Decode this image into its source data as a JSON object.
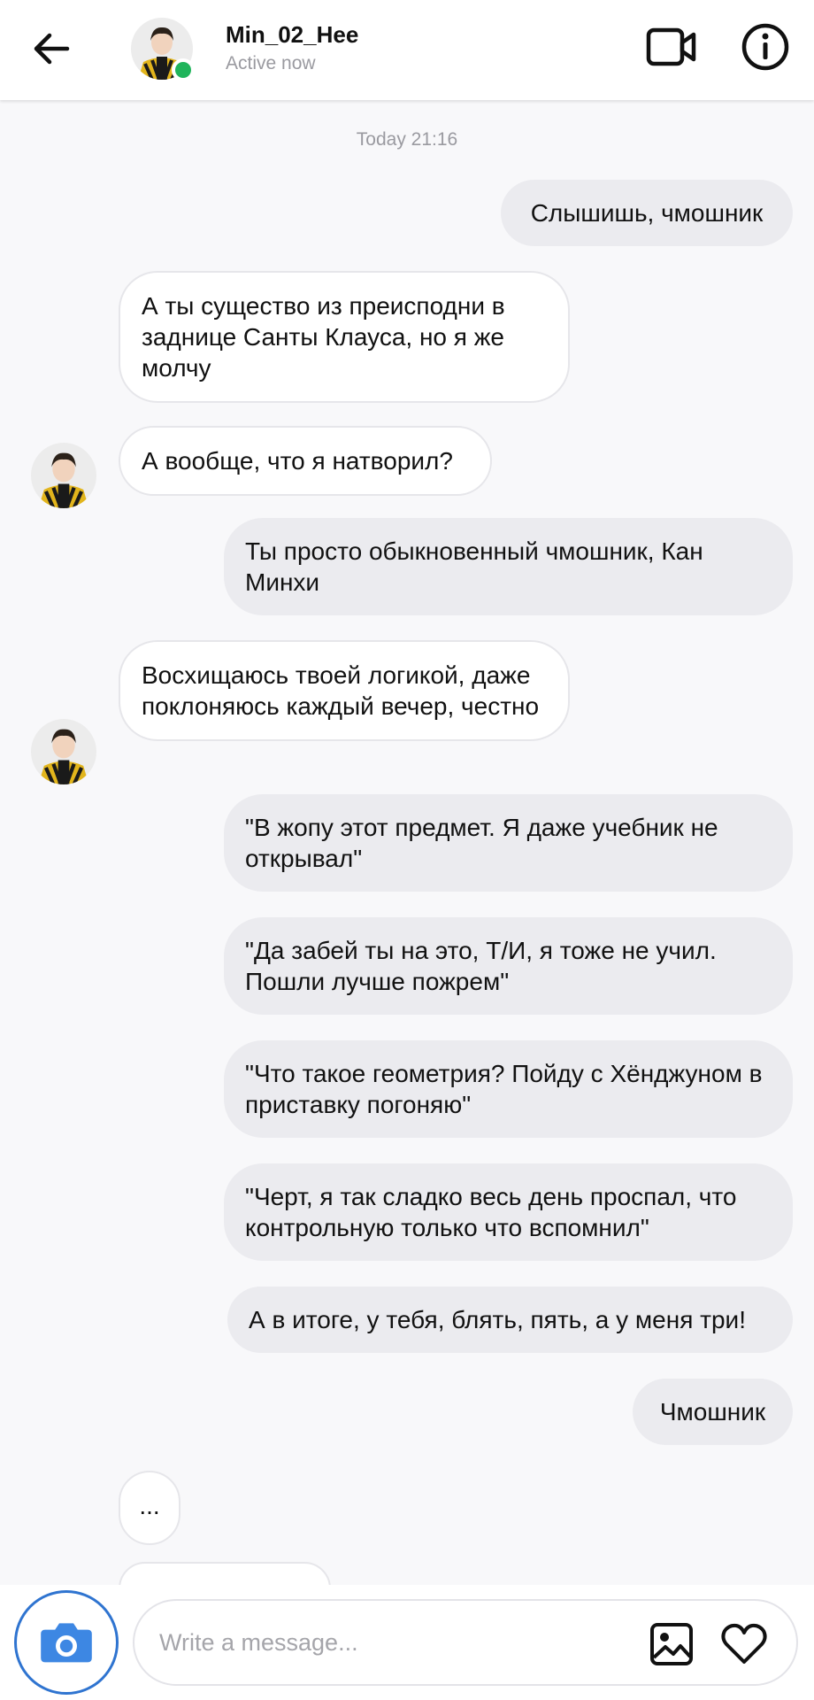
{
  "colors": {
    "online": "#1fb45b",
    "outgoing_bubble": "#ebebef",
    "incoming_bubble": "#ffffff",
    "camera_accent": "#2f74d0"
  },
  "header": {
    "back_icon": "arrow-left-icon",
    "avatar_icon": "user-avatar",
    "username": "Min_02_Hee",
    "status": "Active now",
    "video_icon": "video-camera-icon",
    "info_icon": "info-icon"
  },
  "chat": {
    "timestamp": "Today 21:16",
    "messages": [
      {
        "dir": "out",
        "text": "Слышишь, чмошник"
      },
      {
        "dir": "in",
        "text": "А ты существо из преисподни в заднице Санты Клауса, но я же молчу"
      },
      {
        "dir": "in",
        "text": "А вообще, что я натворил?"
      },
      {
        "dir": "out",
        "text": "Ты просто обыкновенный чмошник, Кан Минхи"
      },
      {
        "dir": "in",
        "text": "Восхищаюсь твоей логикой, даже поклоняюсь каждый вечер, честно"
      },
      {
        "dir": "out",
        "text": "\"В жопу этот предмет. Я даже учебник не открывал\""
      },
      {
        "dir": "out",
        "text": "\"Да забей ты на это, Т/И, я тоже не учил. Пошли лучше пожрем\""
      },
      {
        "dir": "out",
        "text": "\"Что такое геометрия? Пойду с Хёнджуном в приставку погоняю\""
      },
      {
        "dir": "out",
        "text": "\"Черт, я так сладко весь день проспал, что контрольную только что вспомнил\""
      },
      {
        "dir": "out",
        "text": "А в итоге, у тебя, блять, пять, а у меня три!"
      },
      {
        "dir": "out",
        "text": "Чмошник"
      },
      {
        "dir": "in",
        "text": "..."
      }
    ]
  },
  "composer": {
    "camera_icon": "camera-icon",
    "placeholder": "Write a message...",
    "gallery_icon": "image-icon",
    "like_icon": "heart-icon"
  }
}
